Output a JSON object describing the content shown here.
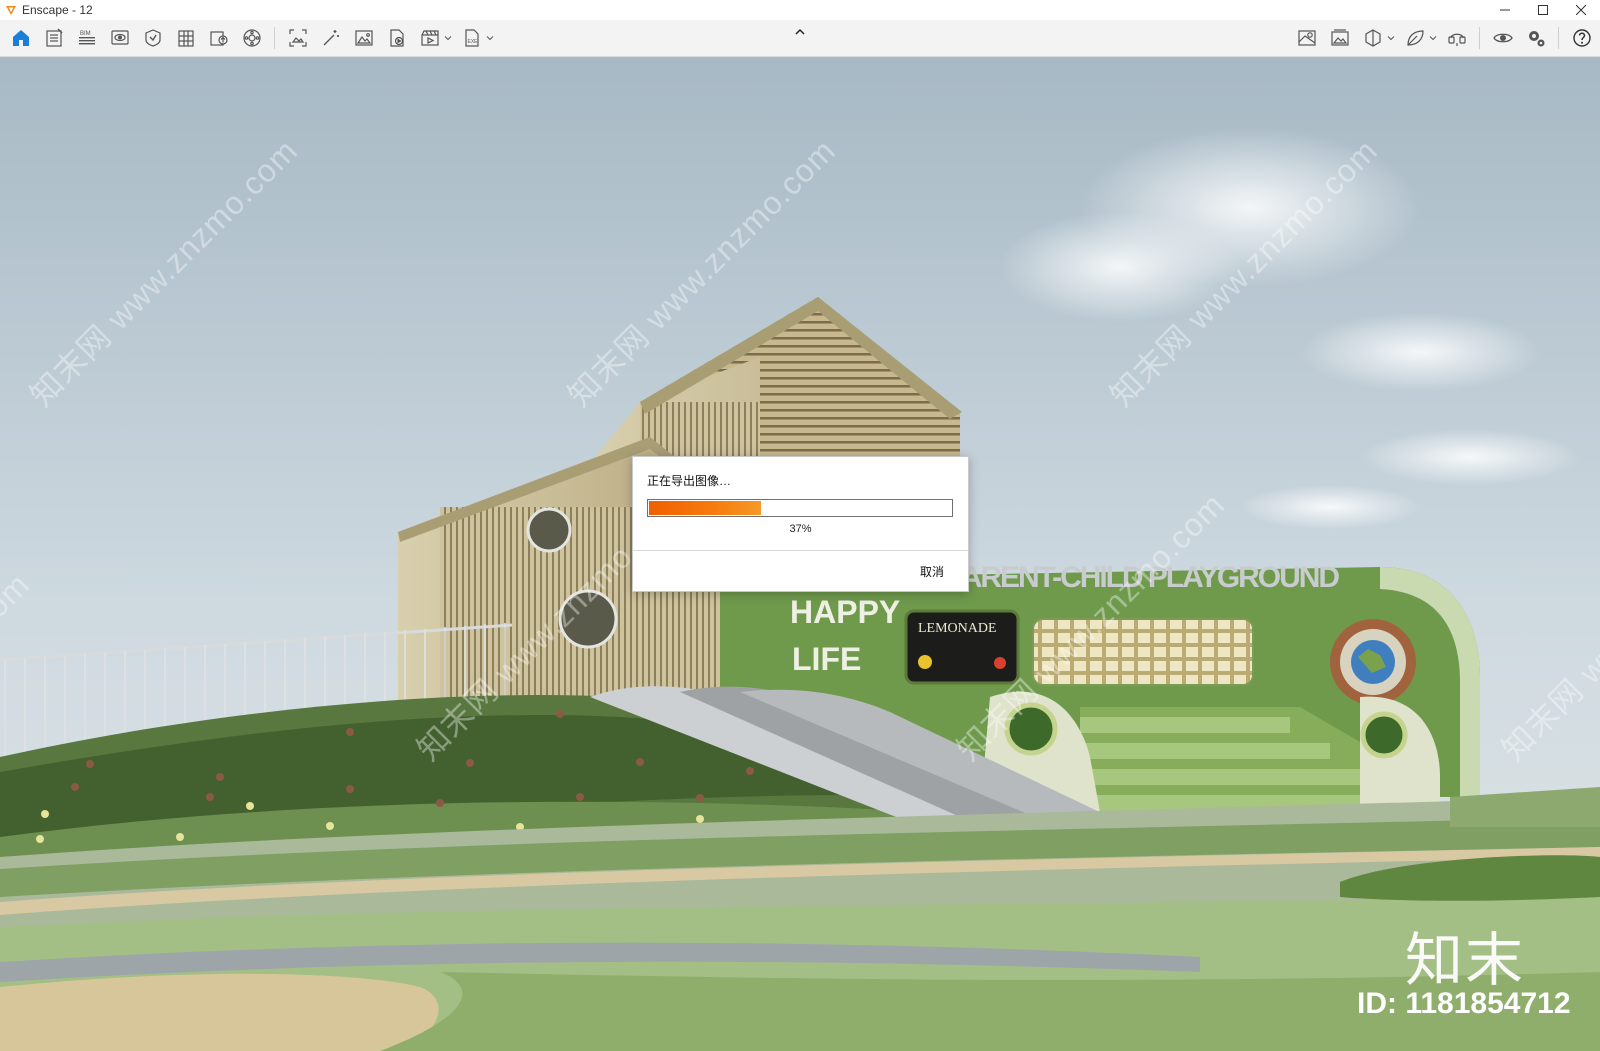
{
  "window": {
    "title": "Enscape - 12",
    "controls": [
      "minimize",
      "maximize",
      "close"
    ]
  },
  "toolbar": {
    "left_icons": [
      "home-icon",
      "document-list-icon",
      "bim-icon",
      "visual-settings-icon",
      "view-management-icon",
      "asset-library-icon",
      "upload-icon",
      "panorama-icon",
      "screenshot-icon",
      "magic-wand-icon",
      "image-icon",
      "render-batch-icon",
      "video-editor-icon",
      "export-icon"
    ],
    "left_labels": {
      "bim": "BIM",
      "exe": "EXE"
    },
    "right_icons": [
      "map-icon",
      "photo-library-icon",
      "cube-section-icon",
      "leaf-icon",
      "vr-headset-icon",
      "eye-icon",
      "settings-icon",
      "help-icon"
    ],
    "collapse_icon": "chevron-up-icon"
  },
  "viewport": {
    "scene_texts": [
      "HAPPY",
      "LIFE",
      "PARENT-CHILD PLAYGROUND",
      "LEMONADE"
    ],
    "watermark": "知末网 www.znzmo.com",
    "brand": {
      "logo": "知末",
      "id": "ID: 1181854712"
    }
  },
  "dialog": {
    "message": "正在导出图像…",
    "progress": 0.37,
    "percent_text": "37%",
    "cancel_label": "取消",
    "accent_color": "#f06000"
  }
}
